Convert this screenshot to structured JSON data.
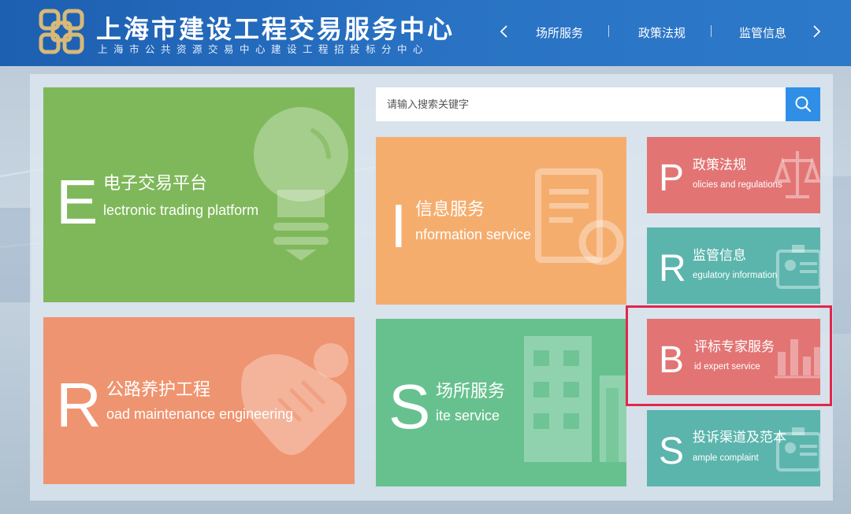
{
  "header": {
    "title": "上海市建设工程交易服务中心",
    "subtitle": "上海市公共资源交易中心建设工程招投标分中心",
    "nav": [
      {
        "label": "场所服务"
      },
      {
        "label": "政策法规"
      },
      {
        "label": "监管信息"
      }
    ]
  },
  "search": {
    "placeholder": "请输入搜索关键字"
  },
  "tiles": {
    "electronic": {
      "letter": "E",
      "cn": "电子交易平台",
      "en": "lectronic trading platform",
      "color": "#7fb85a",
      "icon": "lightbulb-icon"
    },
    "road": {
      "letter": "R",
      "cn": "公路养护工程",
      "en": "oad maintenance engineering",
      "color": "#ef9470",
      "icon": "handshake-icon"
    },
    "information": {
      "letter": "I",
      "cn": "信息服务",
      "en": "nformation service",
      "color": "#f5ad6e",
      "icon": "document-icon"
    },
    "site": {
      "letter": "S",
      "cn": "场所服务",
      "en": "ite service",
      "color": "#67c18f",
      "icon": "building-icon"
    },
    "policies": {
      "letter": "P",
      "cn": "政策法规",
      "en": "olicies and regulations",
      "color": "#e27574",
      "icon": "scales-icon"
    },
    "regulatory": {
      "letter": "R",
      "cn": "监管信息",
      "en": "egulatory information",
      "color": "#5bb5ad",
      "icon": "id-card-icon"
    },
    "bid": {
      "letter": "B",
      "cn": "评标专家服务",
      "en": "id expert service",
      "color": "#e27574",
      "icon": "bar-chart-icon"
    },
    "sample": {
      "letter": "S",
      "cn": "投诉渠道及范本",
      "en": "ample complaint",
      "color": "#5bb5ad",
      "icon": "id-card-icon"
    }
  }
}
